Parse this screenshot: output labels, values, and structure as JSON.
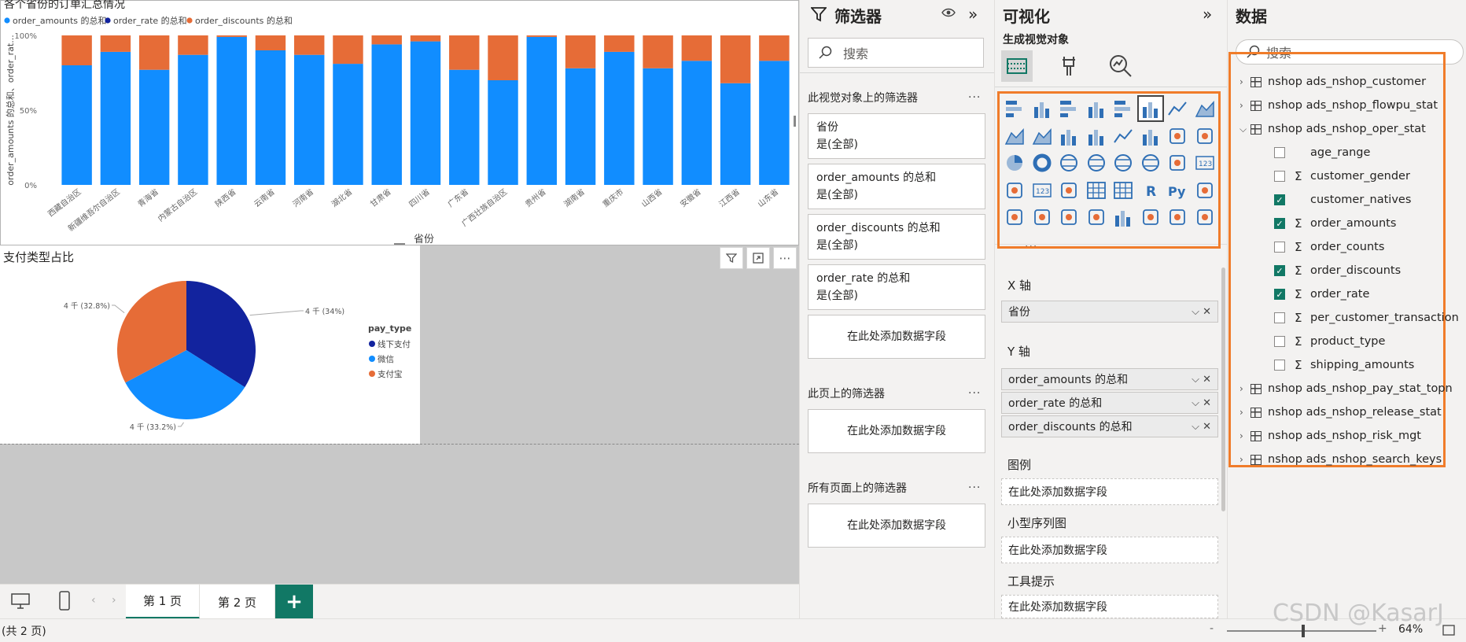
{
  "bar_chart": {
    "title": "各个省份的订单汇总情况",
    "legend": [
      "order_amounts 的总和",
      "order_rate 的总和",
      "order_discounts 的总和"
    ],
    "ylabel": "order_amounts 的总和、order_rat...",
    "xlabel": "省份",
    "yticks": [
      "100%",
      "50%",
      "0%"
    ],
    "chart_data": {
      "type": "bar",
      "stacked": "100%",
      "categories": [
        "西藏自治区",
        "新疆维吾尔自治区",
        "青海省",
        "内蒙古自治区",
        "陕西省",
        "云南省",
        "河南省",
        "湖北省",
        "甘肃省",
        "四川省",
        "广东省",
        "广西壮族自治区",
        "贵州省",
        "湖南省",
        "重庆市",
        "山西省",
        "安徽省",
        "江西省",
        "山东省"
      ],
      "series": [
        {
          "name": "order_amounts 的总和",
          "color": "#118dff",
          "values": [
            80,
            89,
            77,
            87,
            99,
            90,
            87,
            81,
            94,
            96,
            77,
            70,
            99,
            78,
            89,
            78,
            83,
            68,
            83
          ]
        },
        {
          "name": "order_rate 的总和",
          "color": "#12239e",
          "values": [
            0,
            0,
            0,
            0,
            0,
            0,
            0,
            0,
            0,
            0,
            0,
            0,
            0,
            0,
            0,
            0,
            0,
            0,
            0
          ]
        },
        {
          "name": "order_discounts 的总和",
          "color": "#e66c37",
          "values": [
            20,
            11,
            23,
            13,
            1,
            10,
            13,
            19,
            6,
            4,
            23,
            30,
            1,
            22,
            11,
            22,
            17,
            32,
            17
          ]
        }
      ],
      "ylim": [
        0,
        100
      ]
    }
  },
  "pie_chart": {
    "title": "支付类型占比",
    "legend_title": "pay_type",
    "chart_data": {
      "type": "pie",
      "labels": [
        "线下支付",
        "微信",
        "支付宝"
      ],
      "values": [
        34,
        33.2,
        32.8
      ],
      "colors": [
        "#12239e",
        "#118dff",
        "#e66c37"
      ],
      "data_labels": [
        "4 千 (34%)",
        "4 千 (33.2%)",
        "4 千 (32.8%)"
      ]
    }
  },
  "tabs": {
    "page1": "第 1 页",
    "page2": "第 2 页",
    "add": "+"
  },
  "status": {
    "pages": "(共 2 页)",
    "zoom": "64%",
    "minus": "-",
    "plus": "+"
  },
  "filters": {
    "title": "筛选器",
    "search_placeholder": "搜索",
    "visual_section": "此视觉对象上的筛选器",
    "page_section": "此页上的筛选器",
    "all_section": "所有页面上的筛选器",
    "more": "...",
    "cards": [
      {
        "name": "省份",
        "value": "是(全部)"
      },
      {
        "name": "order_amounts 的总和",
        "value": "是(全部)"
      },
      {
        "name": "order_discounts 的总和",
        "value": "是(全部)"
      },
      {
        "name": "order_rate 的总和",
        "value": "是(全部)"
      }
    ],
    "add_field": "在此处添加数据字段"
  },
  "viz": {
    "title": "可视化",
    "build_label": "生成视觉对象",
    "x_axis": "X 轴",
    "x_field": "省份",
    "y_axis": "Y 轴",
    "y_fields": [
      "order_amounts 的总和",
      "order_rate 的总和",
      "order_discounts 的总和"
    ],
    "legend": "图例",
    "small_multiples": "小型序列图",
    "tooltips": "工具提示",
    "add_field": "在此处添加数据字段",
    "more": "..."
  },
  "data": {
    "title": "数据",
    "search_placeholder": "搜索",
    "tables": [
      {
        "label": "nshop ads_nshop_customer"
      },
      {
        "label": "nshop ads_nshop_flowpu_stat"
      },
      {
        "label": "nshop ads_nshop_oper_stat",
        "expanded": true
      }
    ],
    "fields": [
      {
        "label": "age_range",
        "checked": false,
        "sigma": false
      },
      {
        "label": "customer_gender",
        "checked": false,
        "sigma": true
      },
      {
        "label": "customer_natives",
        "checked": true,
        "sigma": false
      },
      {
        "label": "order_amounts",
        "checked": true,
        "sigma": true
      },
      {
        "label": "order_counts",
        "checked": false,
        "sigma": true
      },
      {
        "label": "order_discounts",
        "checked": true,
        "sigma": true
      },
      {
        "label": "order_rate",
        "checked": true,
        "sigma": true
      },
      {
        "label": "per_customer_transaction",
        "checked": false,
        "sigma": true
      },
      {
        "label": "product_type",
        "checked": false,
        "sigma": true
      },
      {
        "label": "shipping_amounts",
        "checked": false,
        "sigma": true
      }
    ],
    "tables_after": [
      {
        "label": "nshop ads_nshop_pay_stat_topn"
      },
      {
        "label": "nshop ads_nshop_release_stat"
      },
      {
        "label": "nshop ads_nshop_risk_mgt"
      },
      {
        "label": "nshop ads_nshop_search_keys"
      }
    ]
  },
  "watermark": "CSDN @KasarJ"
}
